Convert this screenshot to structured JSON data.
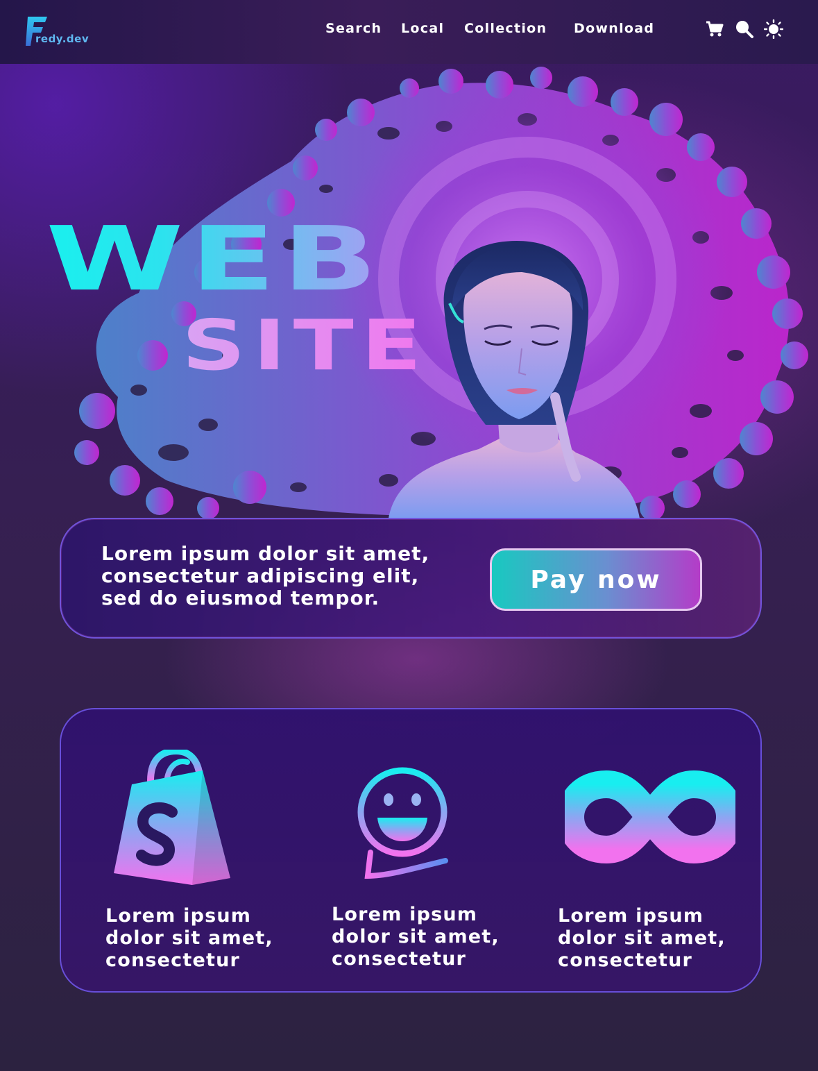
{
  "app": {
    "logo_text": "redy.dev",
    "logo_letter": "F"
  },
  "nav": {
    "items": [
      {
        "label": "Search"
      },
      {
        "label": "Local"
      },
      {
        "label": "Collection"
      },
      {
        "label": "Download"
      }
    ],
    "icons": [
      "cart-icon",
      "search-icon",
      "sun-icon"
    ]
  },
  "hero": {
    "title_line1": "WEB",
    "title_line2": "SITE"
  },
  "cta": {
    "text": "Lorem ipsum dolor sit amet, consectetur adipiscing elit, sed do eiusmod tempor.",
    "button_label": "Pay now"
  },
  "features": [
    {
      "icon": "shopping-bag-icon",
      "text": "Lorem ipsum dolor sit amet, consectetur"
    },
    {
      "icon": "smiley-chat-icon",
      "text": "Lorem ipsum dolor sit amet, consectetur"
    },
    {
      "icon": "infinity-icon",
      "text": "Lorem ipsum dolor sit amet, consectetur"
    }
  ],
  "colors": {
    "accent_cyan": "#19f0ee",
    "accent_pink": "#f077ee",
    "background": "#35204f"
  }
}
